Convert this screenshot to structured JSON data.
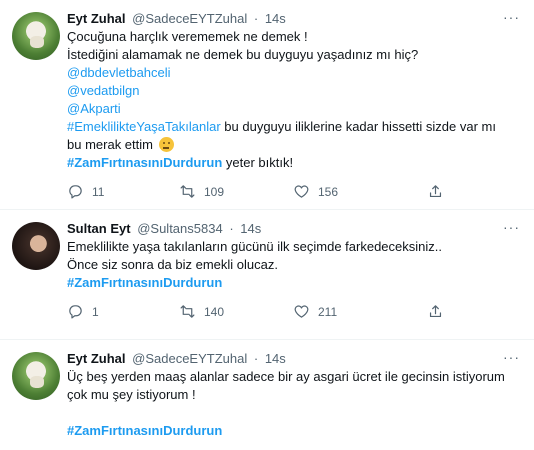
{
  "tweets": [
    {
      "author": "Eyt Zuhal",
      "handle": "@SadeceEYTZuhal",
      "sep": "·",
      "time": "14s",
      "lines": {
        "l1": "Çocuğuna harçlık verememek ne demek !",
        "l2": "İstediğini alamamak ne demek bu duyguyu yaşadınız mı hiç?",
        "m1": "@dbdevletbahceli",
        "m2": "@vedatbilgn",
        "m3": "@Akparti",
        "h1": "#EmeklilikteYaşaTakılanlar",
        "t1": " bu duyguyu iliklerine kadar hissetti sizde var mı",
        "t2": "bu merak ettim ",
        "h2": "#ZamFırtınasınıDurdurun",
        "t3": " yeter bıktık!"
      },
      "reply_count": "11",
      "retweet_count": "109",
      "like_count": "156"
    },
    {
      "author": "Sultan Eyt",
      "handle": "@Sultans5834",
      "sep": "·",
      "time": "14s",
      "lines": {
        "l1": "Emeklilikte yaşa takılanların gücünü ilk seçimde farkedeceksiniz..",
        "l2": "Önce siz sonra da biz emekli olucaz.",
        "h1": "#ZamFırtınasınıDurdurun"
      },
      "reply_count": "1",
      "retweet_count": "140",
      "like_count": "211"
    },
    {
      "author": "Eyt Zuhal",
      "handle": "@SadeceEYTZuhal",
      "sep": "·",
      "time": "14s",
      "lines": {
        "l1": "Üç beş yerden maaş alanlar sadece bir ay asgari ücret ile gecinsin istiyorum",
        "l2": "çok mu şey istiyorum !",
        "h1": "#ZamFırtınasınıDurdurun"
      }
    }
  ],
  "more_label": "···",
  "icons": {
    "more": "more-horizontal-icon",
    "reply": "reply-icon",
    "retweet": "retweet-icon",
    "like": "heart-icon",
    "share": "share-icon",
    "emoji": "thinking-face-emoji"
  }
}
